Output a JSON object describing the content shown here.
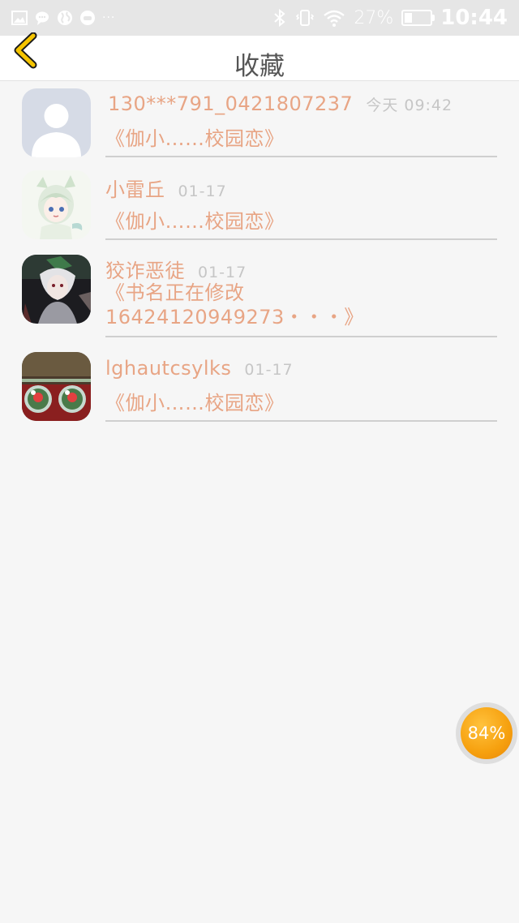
{
  "status_bar": {
    "battery_text": "27%",
    "battery_level": 0.27,
    "time": "10:44",
    "dots": "···",
    "left_icons": [
      "gallery-icon",
      "chat-icon",
      "globe-icon",
      "gamepad-icon"
    ],
    "right_icons": [
      "bluetooth-icon",
      "vibrate-icon",
      "wifi-icon",
      "battery-icon"
    ]
  },
  "header": {
    "title": "收藏",
    "back_icon": "chevron-left-icon",
    "accent_color": "#f5c400"
  },
  "items": [
    {
      "name": "130***791_0421807237",
      "time": "今天 09:42",
      "book": "《伽小……校园恋》",
      "avatar": "default-avatar"
    },
    {
      "name": "小雷丘",
      "time": "01-17",
      "book": "《伽小……校园恋》",
      "avatar": "anime-girl-avatar"
    },
    {
      "name": "狡诈恶徒",
      "time": "01-17",
      "book": "《书名正在修改",
      "book_line2": "16424120949273・・・》",
      "avatar": "dark-anime-avatar"
    },
    {
      "name": "lghautcsylks",
      "time": "01-17",
      "book": "《伽小……校园恋》",
      "avatar": "water-drop-avatar"
    }
  ],
  "float_progress": {
    "label": "84%",
    "color": "#f6a00e"
  },
  "colors": {
    "name": "#e8a585",
    "time": "#c6c6c6",
    "divider": "#cfcfcf",
    "background": "#f6f6f6"
  }
}
